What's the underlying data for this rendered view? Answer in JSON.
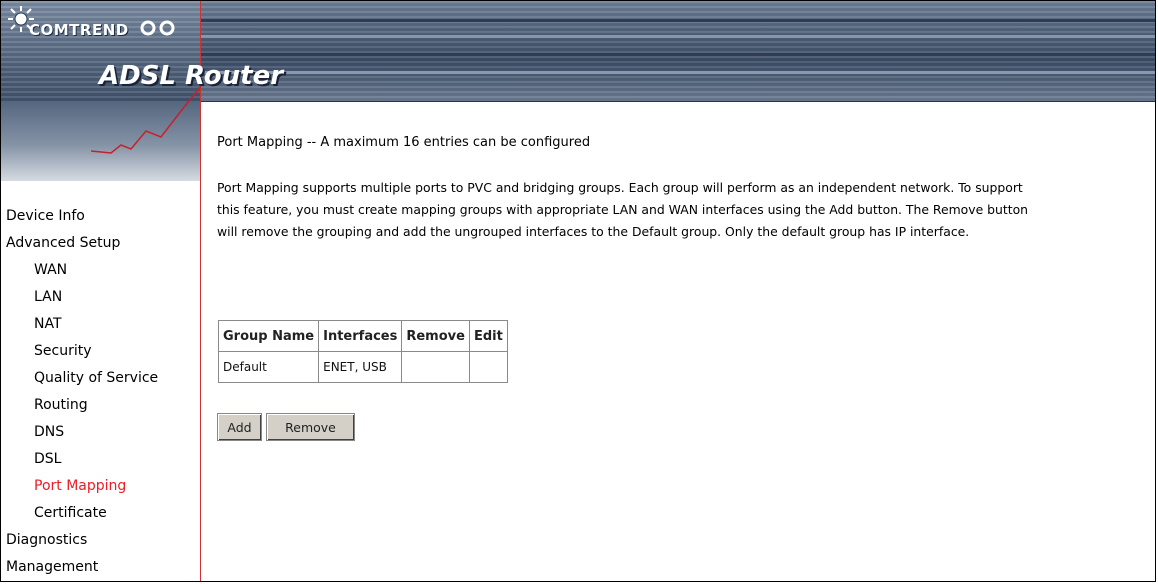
{
  "header": {
    "brand": "COMTREND",
    "product": "ADSL Router"
  },
  "sidebar": {
    "items": [
      {
        "label": "Device Info",
        "level": "top",
        "active": false
      },
      {
        "label": "Advanced Setup",
        "level": "top",
        "active": false
      },
      {
        "label": "WAN",
        "level": "sub",
        "active": false
      },
      {
        "label": "LAN",
        "level": "sub",
        "active": false
      },
      {
        "label": "NAT",
        "level": "sub",
        "active": false
      },
      {
        "label": "Security",
        "level": "sub",
        "active": false
      },
      {
        "label": "Quality of Service",
        "level": "sub",
        "active": false
      },
      {
        "label": "Routing",
        "level": "sub",
        "active": false
      },
      {
        "label": "DNS",
        "level": "sub",
        "active": false
      },
      {
        "label": "DSL",
        "level": "sub",
        "active": false
      },
      {
        "label": "Port Mapping",
        "level": "sub",
        "active": true
      },
      {
        "label": "Certificate",
        "level": "sub",
        "active": false
      },
      {
        "label": "Diagnostics",
        "level": "top",
        "active": false
      },
      {
        "label": "Management",
        "level": "top",
        "active": false
      }
    ]
  },
  "main": {
    "title": "Port Mapping -- A maximum 16 entries can be configured",
    "description_lines": [
      "Port Mapping supports multiple ports to PVC and bridging groups. Each group will perform as an independent network. To support",
      "this feature, you must create mapping groups with appropriate LAN and WAN interfaces using the Add button. The Remove button",
      "will remove the grouping and add the ungrouped interfaces to the Default group. Only the default group has IP interface."
    ],
    "table": {
      "headers": [
        "Group Name",
        "Interfaces",
        "Remove",
        "Edit"
      ],
      "rows": [
        [
          "Default",
          "ENET, USB",
          "",
          ""
        ]
      ]
    },
    "buttons": {
      "add": "Add",
      "remove": "Remove"
    }
  },
  "colors": {
    "active_menu": "#ee1c25",
    "banner": "#4e6078",
    "sidebar_border": "#cc3333"
  }
}
